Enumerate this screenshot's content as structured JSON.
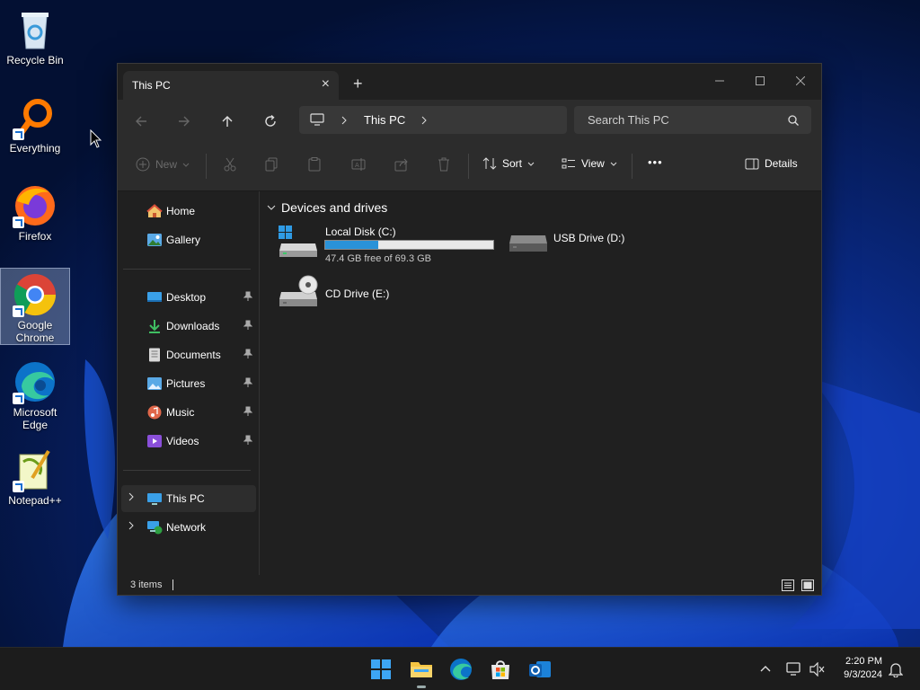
{
  "desktop": {
    "icons": [
      {
        "label": "Recycle Bin",
        "icon": "recycle-bin-icon"
      },
      {
        "label": "Everything",
        "icon": "everything-search-icon"
      },
      {
        "label": "Firefox",
        "icon": "firefox-icon"
      },
      {
        "label": "Google Chrome",
        "icon": "chrome-icon",
        "selected": true
      },
      {
        "label": "Microsoft Edge",
        "icon": "edge-icon"
      },
      {
        "label": "Notepad++",
        "icon": "notepad-plus-plus-icon"
      }
    ]
  },
  "window": {
    "tab_title": "This PC",
    "new_tab": "+",
    "address": {
      "segment": "This PC"
    },
    "search": {
      "placeholder": "Search This PC"
    },
    "commands": {
      "new_label": "New",
      "sort_label": "Sort",
      "view_label": "View",
      "more_label": "•••",
      "details_label": "Details"
    },
    "sidebar": {
      "quick": [
        {
          "label": "Home",
          "icon": "home-icon"
        },
        {
          "label": "Gallery",
          "icon": "gallery-icon"
        }
      ],
      "pinned": [
        {
          "label": "Desktop",
          "icon": "desktop-folder-icon"
        },
        {
          "label": "Downloads",
          "icon": "downloads-icon"
        },
        {
          "label": "Documents",
          "icon": "documents-icon"
        },
        {
          "label": "Pictures",
          "icon": "pictures-icon"
        },
        {
          "label": "Music",
          "icon": "music-icon"
        },
        {
          "label": "Videos",
          "icon": "videos-icon"
        }
      ],
      "locations": [
        {
          "label": "This PC",
          "icon": "this-pc-icon",
          "active": true
        },
        {
          "label": "Network",
          "icon": "network-icon"
        }
      ]
    },
    "content": {
      "group_title": "Devices and drives",
      "drives": [
        {
          "name": "Local Disk (C:)",
          "free_text": "47.4 GB free of 69.3 GB",
          "used_fraction": 0.316
        },
        {
          "name": "USB Drive (D:)"
        },
        {
          "name": "CD Drive (E:)"
        }
      ]
    },
    "status": {
      "items": "3 items"
    }
  },
  "taskbar": {
    "time": "2:20 PM",
    "date": "9/3/2024"
  },
  "colors": {
    "accent": "#2a92d8",
    "window_bg": "#202020",
    "toolbar_bg": "#2c2c2c",
    "taskbar_bg": "#1c1c1c"
  }
}
